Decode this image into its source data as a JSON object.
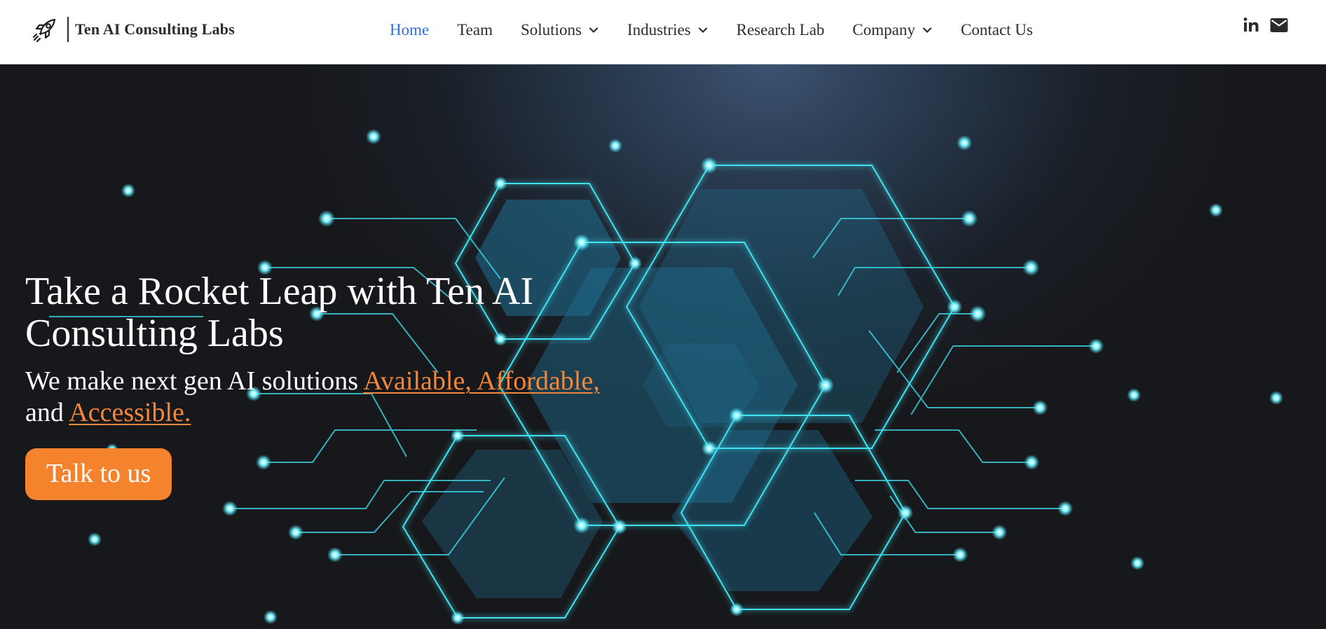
{
  "header": {
    "brand_name": "Ten AI Consulting Labs",
    "logo_icon": "rocket-icon",
    "nav": [
      {
        "label": "Home",
        "active": true,
        "dropdown": false
      },
      {
        "label": "Team",
        "active": false,
        "dropdown": false
      },
      {
        "label": "Solutions",
        "active": false,
        "dropdown": true
      },
      {
        "label": "Industries",
        "active": false,
        "dropdown": true
      },
      {
        "label": "Research Lab",
        "active": false,
        "dropdown": false
      },
      {
        "label": "Company",
        "active": false,
        "dropdown": true
      },
      {
        "label": "Contact Us",
        "active": false,
        "dropdown": false
      }
    ],
    "social_icons": [
      "linkedin-icon",
      "mail-icon"
    ]
  },
  "hero": {
    "title": "Take a Rocket Leap with Ten AI Consulting Labs",
    "subtitle_prefix": "We make next gen AI solutions ",
    "highlight_1": "Available, Affordable,",
    "subtitle_mid": "and ",
    "highlight_2": "Accessible.",
    "cta_label": "Talk to us"
  },
  "colors": {
    "nav_active": "#2f6fde",
    "accent": "#f5822d",
    "highlight_text": "#f5873a",
    "circuit_glow": "#3fe3f2",
    "hero_dark": "#17181b"
  }
}
